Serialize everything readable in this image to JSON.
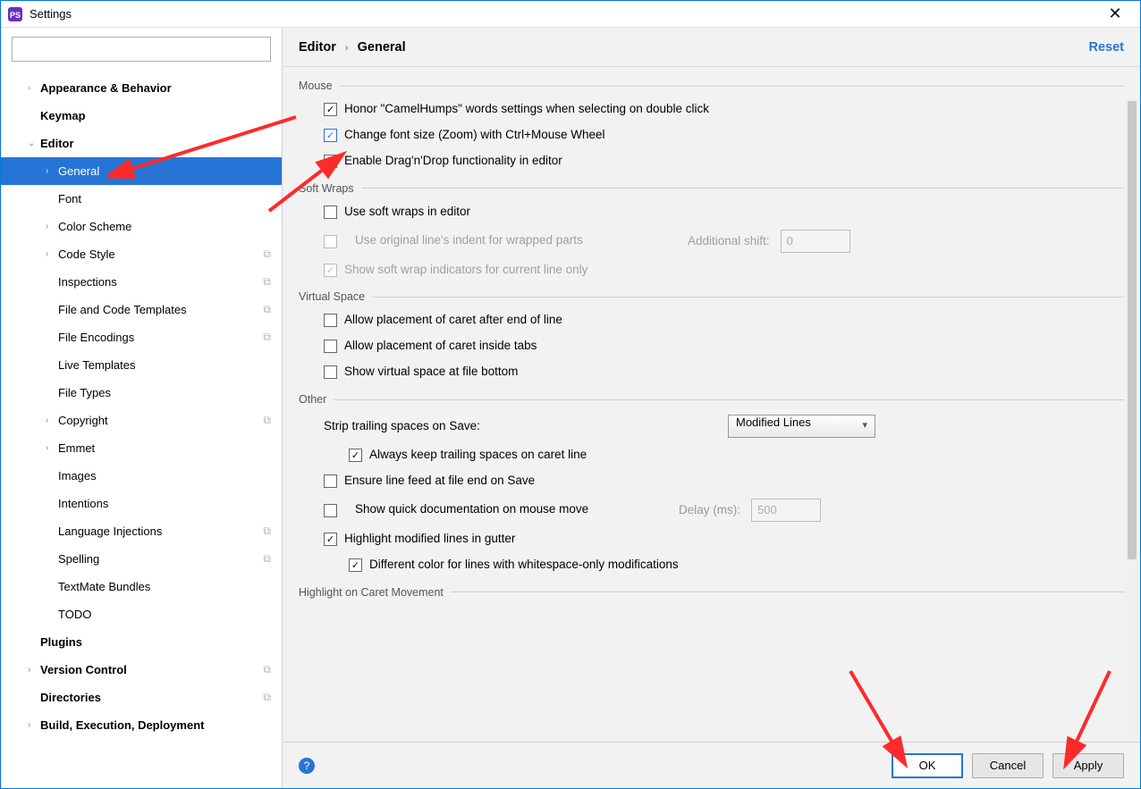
{
  "window": {
    "title": "Settings"
  },
  "search": {
    "placeholder": ""
  },
  "sidebar": {
    "items": [
      {
        "label": "Appearance & Behavior",
        "bold": true,
        "depth": 1,
        "exp": "›",
        "badge": ""
      },
      {
        "label": "Keymap",
        "bold": true,
        "depth": 1,
        "exp": "",
        "badge": ""
      },
      {
        "label": "Editor",
        "bold": true,
        "depth": 1,
        "exp": "⌄",
        "badge": ""
      },
      {
        "label": "General",
        "bold": false,
        "depth": 2,
        "exp": "›",
        "badge": "",
        "selected": true
      },
      {
        "label": "Font",
        "bold": false,
        "depth": 2,
        "exp": "",
        "badge": ""
      },
      {
        "label": "Color Scheme",
        "bold": false,
        "depth": 2,
        "exp": "›",
        "badge": ""
      },
      {
        "label": "Code Style",
        "bold": false,
        "depth": 2,
        "exp": "›",
        "badge": "⧉"
      },
      {
        "label": "Inspections",
        "bold": false,
        "depth": 2,
        "exp": "",
        "badge": "⧉"
      },
      {
        "label": "File and Code Templates",
        "bold": false,
        "depth": 2,
        "exp": "",
        "badge": "⧉"
      },
      {
        "label": "File Encodings",
        "bold": false,
        "depth": 2,
        "exp": "",
        "badge": "⧉"
      },
      {
        "label": "Live Templates",
        "bold": false,
        "depth": 2,
        "exp": "",
        "badge": ""
      },
      {
        "label": "File Types",
        "bold": false,
        "depth": 2,
        "exp": "",
        "badge": ""
      },
      {
        "label": "Copyright",
        "bold": false,
        "depth": 2,
        "exp": "›",
        "badge": "⧉"
      },
      {
        "label": "Emmet",
        "bold": false,
        "depth": 2,
        "exp": "›",
        "badge": ""
      },
      {
        "label": "Images",
        "bold": false,
        "depth": 2,
        "exp": "",
        "badge": ""
      },
      {
        "label": "Intentions",
        "bold": false,
        "depth": 2,
        "exp": "",
        "badge": ""
      },
      {
        "label": "Language Injections",
        "bold": false,
        "depth": 2,
        "exp": "",
        "badge": "⧉"
      },
      {
        "label": "Spelling",
        "bold": false,
        "depth": 2,
        "exp": "",
        "badge": "⧉"
      },
      {
        "label": "TextMate Bundles",
        "bold": false,
        "depth": 2,
        "exp": "",
        "badge": ""
      },
      {
        "label": "TODO",
        "bold": false,
        "depth": 2,
        "exp": "",
        "badge": ""
      },
      {
        "label": "Plugins",
        "bold": true,
        "depth": 1,
        "exp": "",
        "badge": ""
      },
      {
        "label": "Version Control",
        "bold": true,
        "depth": 1,
        "exp": "›",
        "badge": "⧉"
      },
      {
        "label": "Directories",
        "bold": true,
        "depth": 1,
        "exp": "",
        "badge": "⧉"
      },
      {
        "label": "Build, Execution, Deployment",
        "bold": true,
        "depth": 1,
        "exp": "›",
        "badge": ""
      }
    ]
  },
  "breadcrumb": {
    "root": "Editor",
    "sep": "›",
    "leaf": "General"
  },
  "reset": "Reset",
  "sections": {
    "mouse": {
      "title": "Mouse",
      "opt1": "Honor \"CamelHumps\" words settings when selecting on double click",
      "opt2": "Change font size (Zoom) with Ctrl+Mouse Wheel",
      "opt3": "Enable Drag'n'Drop functionality in editor"
    },
    "softwraps": {
      "title": "Soft Wraps",
      "opt1": "Use soft wraps in editor",
      "opt2": "Use original line's indent for wrapped parts",
      "opt2_extra_label": "Additional shift:",
      "opt2_extra_value": "0",
      "opt3": "Show soft wrap indicators for current line only"
    },
    "virtual": {
      "title": "Virtual Space",
      "opt1": "Allow placement of caret after end of line",
      "opt2": "Allow placement of caret inside tabs",
      "opt3": "Show virtual space at file bottom"
    },
    "other": {
      "title": "Other",
      "strip_label": "Strip trailing spaces on Save:",
      "strip_value": "Modified Lines",
      "opt1": "Always keep trailing spaces on caret line",
      "opt2": "Ensure line feed at file end on Save",
      "opt3": "Show quick documentation on mouse move",
      "opt3_delay_label": "Delay (ms):",
      "opt3_delay_value": "500",
      "opt4": "Highlight modified lines in gutter",
      "opt5": "Different color for lines with whitespace-only modifications"
    },
    "caret": {
      "title": "Highlight on Caret Movement"
    }
  },
  "footer": {
    "ok": "OK",
    "cancel": "Cancel",
    "apply": "Apply"
  }
}
